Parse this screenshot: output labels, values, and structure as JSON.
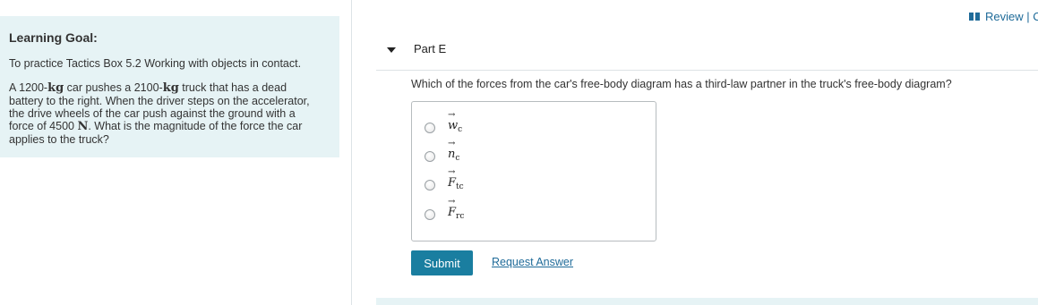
{
  "learning_goal": {
    "title": "Learning Goal:",
    "intro": "To practice Tactics Box 5.2 Working with objects in contact.",
    "body_p1": "A 1200-",
    "unit_kg": "kg",
    "body_p2": " car pushes a 2100-",
    "body_p3": " truck that has a dead battery to the right. When the driver steps on the accelerator, the drive wheels of the car push against the ground with a force of 4500 ",
    "unit_N": "N",
    "body_p4": ". What is the magnitude of the force the car applies to the truck?"
  },
  "header": {
    "review_label": "Review | C"
  },
  "part": {
    "title": "Part E",
    "question": "Which of the forces from the car's free-body diagram has a third-law partner in the truck's free-body diagram?"
  },
  "options": [
    {
      "symbol": "w",
      "sub": "c"
    },
    {
      "symbol": "n",
      "sub": "c"
    },
    {
      "symbol": "F",
      "sub": "tc"
    },
    {
      "symbol": "F",
      "sub": "rc"
    }
  ],
  "actions": {
    "submit_label": "Submit",
    "request_label": "Request Answer"
  },
  "colors": {
    "panel_bg": "#e6f3f5",
    "accent": "#1a7ea0",
    "link": "#1f6b99"
  }
}
